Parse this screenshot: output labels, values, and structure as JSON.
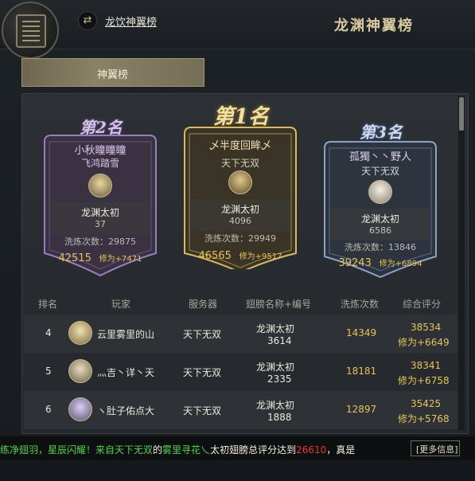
{
  "header": {
    "switch_icon": "swap-arrows-icon",
    "switch_label": "龙饮神翼榜",
    "title": "龙渊神翼榜"
  },
  "tabs": [
    {
      "label": "神翼榜",
      "active": true
    }
  ],
  "podium": {
    "first": {
      "rank_label": "第1名",
      "player": "乄半度回眸乄",
      "server": "天下无双",
      "wing_name": "龙渊太初",
      "wing_number": "4096",
      "refine_label": "洗炼次数：",
      "refine_count": "29949",
      "score": "46565",
      "bonus": "修为+9517"
    },
    "second": {
      "rank_label": "第2名",
      "player": "小秋瞳瞳瞳",
      "server": "飞鸿踏雪",
      "wing_name": "龙渊太初",
      "wing_number": "37",
      "refine_label": "洗炼次数：",
      "refine_count": "29875",
      "score": "42515",
      "bonus": "修为+7471"
    },
    "third": {
      "rank_label": "第3名",
      "player": "孤獨丶丶野人",
      "server": "天下无双",
      "wing_name": "龙渊太初",
      "wing_number": "6586",
      "refine_label": "洗炼次数：",
      "refine_count": "13846",
      "score": "39243",
      "bonus": "修为+6894"
    }
  },
  "table": {
    "columns": [
      "排名",
      "玩家",
      "服务器",
      "翅膀名称+编号",
      "洗炼次数",
      "综合评分"
    ],
    "rows": [
      {
        "rank": "4",
        "player": "云里雾里的山",
        "server": "天下无双",
        "wing_name": "龙渊太初",
        "wing_number": "3614",
        "refine": "14349",
        "score": "38534",
        "bonus": "修为+6649"
      },
      {
        "rank": "5",
        "player": "灬吉丶详丶天",
        "server": "天下无双",
        "wing_name": "龙渊太初",
        "wing_number": "2335",
        "refine": "18181",
        "score": "38341",
        "bonus": "修为+6758"
      },
      {
        "rank": "6",
        "player": "ヽ肚子佑点大",
        "server": "天下无双",
        "wing_name": "龙渊太初",
        "wing_number": "1888",
        "refine": "12897",
        "score": "35425",
        "bonus": "修为+5768"
      }
    ]
  },
  "ticker": {
    "part1": "练净翅羽，星辰闪耀！来自",
    "server": "天下无双",
    "part2": "的",
    "player": "雾里寻花乀",
    "part3": "太初翅膀总评分达到",
    "score": "26610",
    "part4": "，真是",
    "more_label": "[更多信息]"
  },
  "colors": {
    "gold": "#e6c35a",
    "ticker_green": "#4fd44a",
    "ticker_red": "#e83a2a",
    "second_theme": "#9a7cc0",
    "first_theme": "#d8b862",
    "third_theme": "#8aa2c8"
  }
}
